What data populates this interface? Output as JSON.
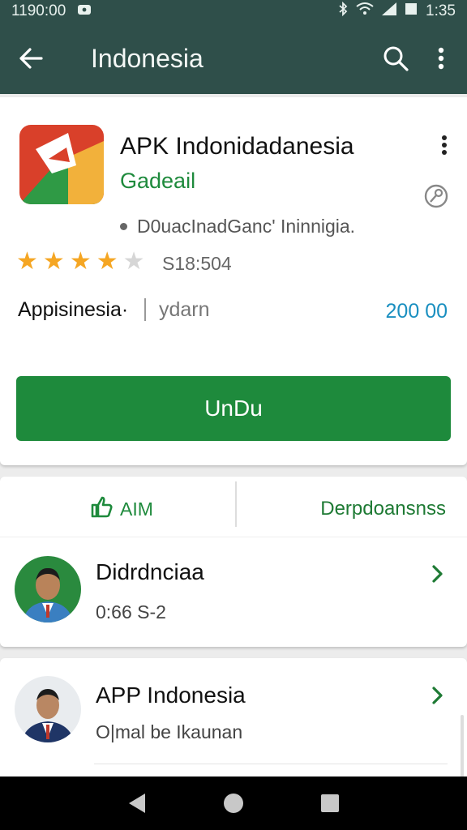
{
  "status_bar": {
    "time_left": "1190:00",
    "time_right": "1:35"
  },
  "app_bar": {
    "title": "Indonesia",
    "back_icon": "arrow-left-icon",
    "search_icon": "search-icon",
    "more_icon": "more-vert-icon"
  },
  "app": {
    "name": "APK Indonidadanesia",
    "developer": "Gadeail",
    "meta": "D0uacInadGanc' Ininnigia.",
    "rating": 4,
    "rating_count": "S18:504",
    "category": "Appisinesia·",
    "category_sub": "ydarn",
    "price": "200 00",
    "install_label": "UnDu",
    "colors": {
      "accent": "#1e8a3c",
      "toolbar": "#2f4f4a",
      "price": "#1a8fc0"
    }
  },
  "actions": {
    "like_label": "AIM",
    "details_label": "Derpdoansnss"
  },
  "list": [
    {
      "title": "Didrdnciaa",
      "subtitle": "0:66 S-2"
    },
    {
      "title": "APP Indonesia",
      "subtitle": "O|mal be Ikaunan"
    }
  ]
}
